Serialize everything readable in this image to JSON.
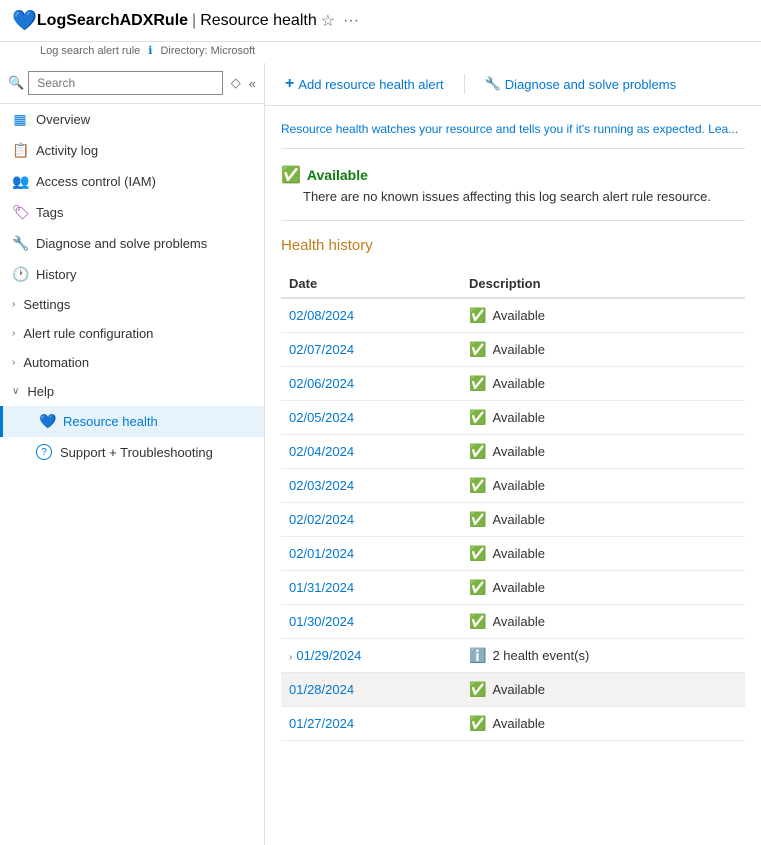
{
  "header": {
    "icon": "💙",
    "title": "LogSearchADXRule",
    "separator": "|",
    "page": "Resource health",
    "subtitle_type": "Log search alert rule",
    "info_label": "ℹ",
    "directory_label": "Directory: Microsoft",
    "star": "☆",
    "more": "···"
  },
  "sidebar": {
    "search_placeholder": "Search",
    "collapse_icon": "«",
    "filter_icon": "◇",
    "items": [
      {
        "id": "overview",
        "label": "Overview",
        "icon": "▦",
        "icon_color": "#0078d4"
      },
      {
        "id": "activity-log",
        "label": "Activity log",
        "icon": "📋",
        "icon_color": "#0078d4"
      },
      {
        "id": "access-control",
        "label": "Access control (IAM)",
        "icon": "👥",
        "icon_color": "#0078d4"
      },
      {
        "id": "tags",
        "label": "Tags",
        "icon": "🏷",
        "icon_color": "#9c27b0"
      },
      {
        "id": "diagnose",
        "label": "Diagnose and solve problems",
        "icon": "🔧",
        "icon_color": "#0078d4"
      },
      {
        "id": "history",
        "label": "History",
        "icon": "🕐",
        "icon_color": "#0078d4"
      },
      {
        "id": "settings",
        "label": "Settings",
        "icon": "",
        "chevron": "›",
        "icon_color": "#333"
      },
      {
        "id": "alert-rule",
        "label": "Alert rule configuration",
        "icon": "",
        "chevron": "›",
        "icon_color": "#333"
      },
      {
        "id": "automation",
        "label": "Automation",
        "icon": "",
        "chevron": "›",
        "icon_color": "#333"
      },
      {
        "id": "help",
        "label": "Help",
        "icon": "",
        "chevron": "∨",
        "icon_color": "#333"
      },
      {
        "id": "resource-health",
        "label": "Resource health",
        "icon": "💙",
        "icon_color": "#0078d4",
        "active": true,
        "sub": true
      },
      {
        "id": "support",
        "label": "Support + Troubleshooting",
        "icon": "?",
        "icon_color": "#0078d4",
        "sub": true
      }
    ]
  },
  "toolbar": {
    "add_alert_icon": "+",
    "add_alert_label": "Add resource health alert",
    "diagnose_icon": "🔧",
    "diagnose_label": "Diagnose and solve problems"
  },
  "content": {
    "info_text": "Resource health watches your resource and tells you if it's running as expected. Lea...",
    "status": "Available",
    "status_desc": "There are no known issues affecting this log search alert rule resource.",
    "section_title": "Health history",
    "table_headers": [
      "Date",
      "Description"
    ],
    "history_rows": [
      {
        "date": "02/08/2024",
        "status": "Available",
        "type": "available"
      },
      {
        "date": "02/07/2024",
        "status": "Available",
        "type": "available"
      },
      {
        "date": "02/06/2024",
        "status": "Available",
        "type": "available"
      },
      {
        "date": "02/05/2024",
        "status": "Available",
        "type": "available"
      },
      {
        "date": "02/04/2024",
        "status": "Available",
        "type": "available"
      },
      {
        "date": "02/03/2024",
        "status": "Available",
        "type": "available"
      },
      {
        "date": "02/02/2024",
        "status": "Available",
        "type": "available"
      },
      {
        "date": "02/01/2024",
        "status": "Available",
        "type": "available"
      },
      {
        "date": "01/31/2024",
        "status": "Available",
        "type": "available"
      },
      {
        "date": "01/30/2024",
        "status": "Available",
        "type": "available"
      },
      {
        "date": "01/29/2024",
        "status": "2 health event(s)",
        "type": "event",
        "expandable": true
      },
      {
        "date": "01/28/2024",
        "status": "Available",
        "type": "available",
        "highlight": true
      },
      {
        "date": "01/27/2024",
        "status": "Available",
        "type": "available"
      }
    ]
  }
}
